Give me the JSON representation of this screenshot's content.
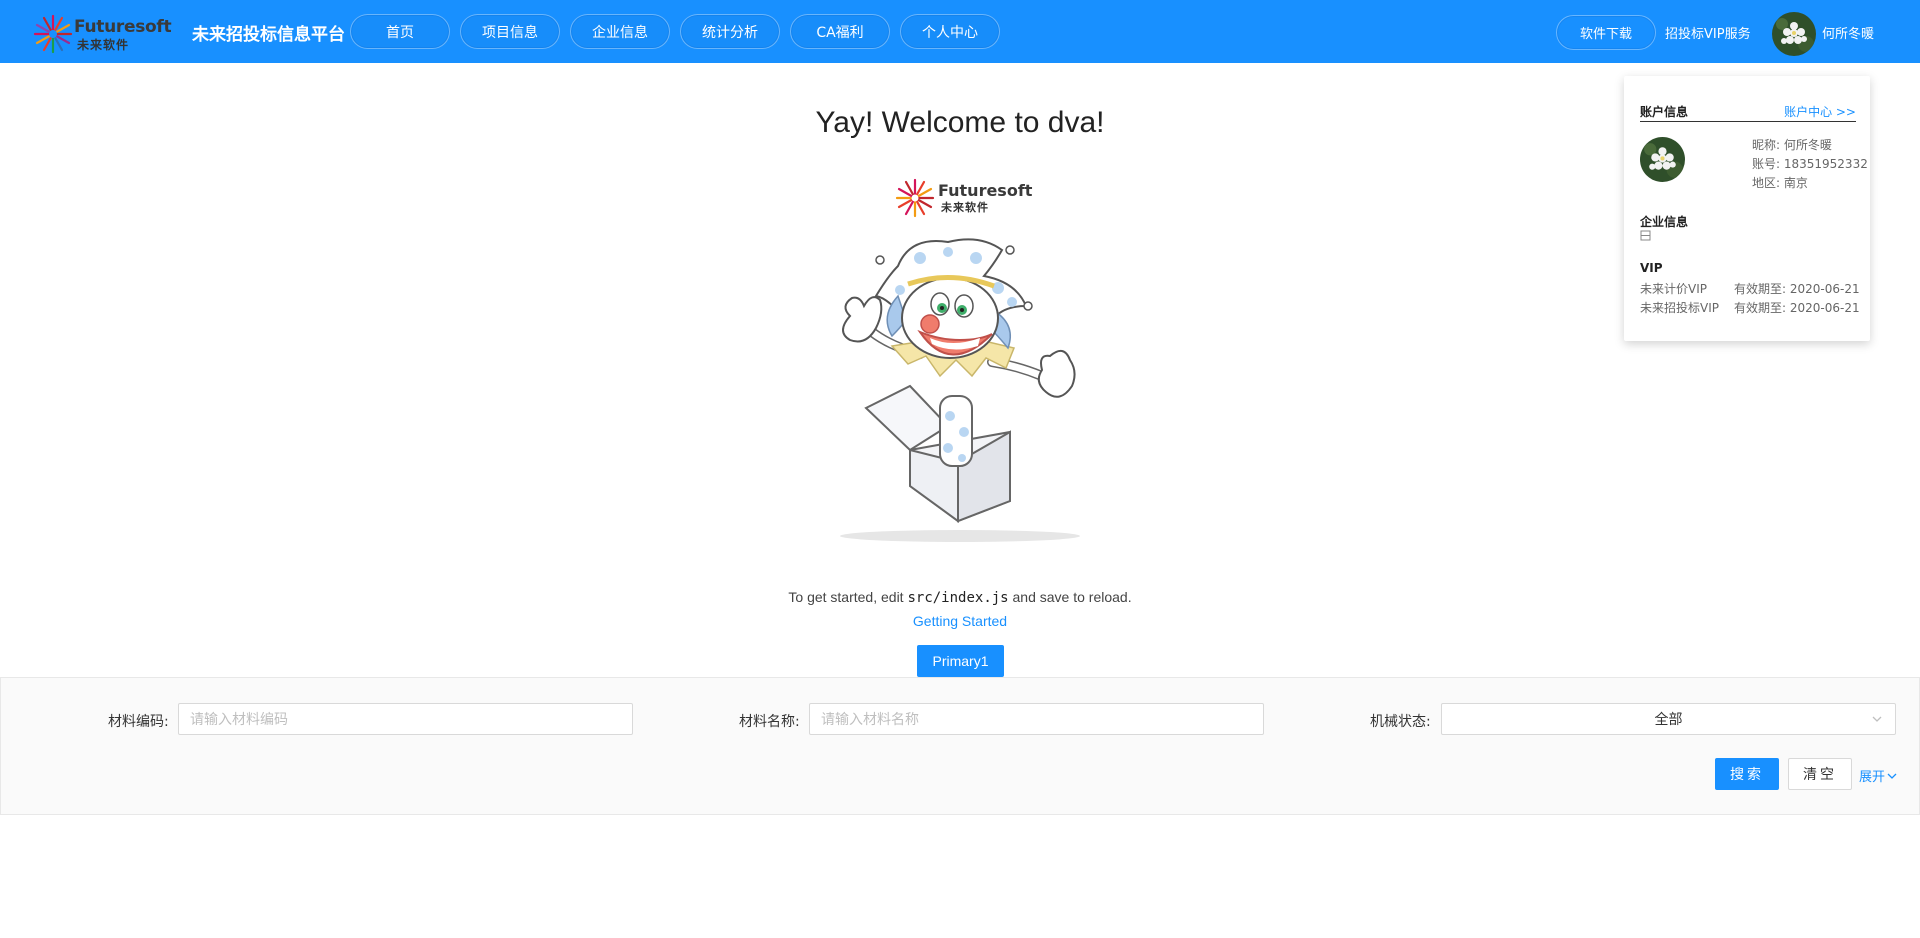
{
  "header": {
    "logo_en": "Futuresoft",
    "logo_cn": "未来软件",
    "platform_title": "未来招投标信息平台",
    "nav": [
      "首页",
      "项目信息",
      "企业信息",
      "统计分析",
      "CA福利",
      "个人中心"
    ],
    "download_label": "软件下载",
    "vip_service_label": "招投标VIP服务",
    "user_name": "何所冬暖",
    "accent_color": "#1890ff"
  },
  "main": {
    "welcome": "Yay! Welcome to dva!",
    "logo_en": "Futuresoft",
    "logo_cn": "未来软件",
    "instructions_pre": "To get started, edit ",
    "instructions_code": "src/index.js",
    "instructions_post": " and save to reload.",
    "getting_started": "Getting Started",
    "primary_button": "Primary1"
  },
  "filter": {
    "material_code_label": "材料编码:",
    "material_code_placeholder": "请输入材料编码",
    "material_name_label": "材料名称:",
    "material_name_placeholder": "请输入材料名称",
    "machine_status_label": "机械状态:",
    "machine_status_value": "全部",
    "search_button": "搜索",
    "clear_button": "清空",
    "expand_link": "展开"
  },
  "account": {
    "title": "账户信息",
    "center_link": "账户中心 >>",
    "nickname": "昵称: 何所冬暖",
    "account_no": "账号: 18351952332",
    "region": "地区: 南京",
    "company_section": "企业信息",
    "vip_section": "VIP",
    "vip_items": [
      {
        "name": "未来计价VIP",
        "expiry": "有效期至: 2020-06-21"
      },
      {
        "name": "未来招投标VIP",
        "expiry": "有效期至: 2020-06-21"
      }
    ]
  }
}
